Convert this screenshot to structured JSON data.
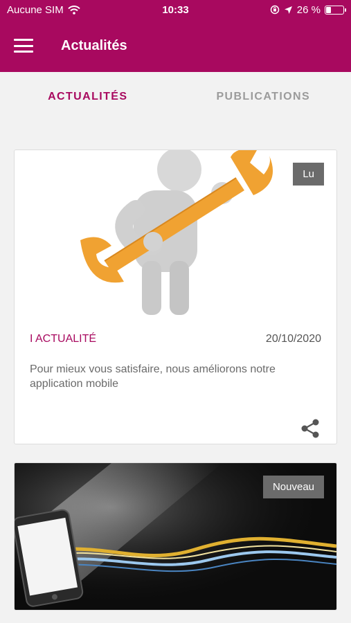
{
  "status_bar": {
    "carrier": "Aucune SIM",
    "time": "10:33",
    "battery_text": "26 %",
    "battery_level": 0.26,
    "icons": [
      "wifi-icon",
      "screen-lock-icon",
      "location-icon",
      "battery-icon"
    ]
  },
  "app_bar": {
    "title": "Actualités",
    "menu_icon": "hamburger-icon"
  },
  "tabs": [
    {
      "label": "ACTUALITÉS",
      "active": true
    },
    {
      "label": "PUBLICATIONS",
      "active": false
    }
  ],
  "cards": [
    {
      "image": "3D figure holding an orange wrench",
      "badge": "Lu",
      "category": "I ACTUALITÉ",
      "date": "20/10/2020",
      "excerpt": "Pour mieux vous satisfaire, nous améliorons notre application mobile",
      "share_icon": "share-icon"
    },
    {
      "image": "smartphone with light waves on dark background",
      "badge": "Nouveau"
    }
  ],
  "colors": {
    "primary": "#a8095f",
    "background": "#f2f2f2",
    "badge": "#6b6b6b",
    "tab_inactive": "#9b9b9b",
    "text_muted": "#6a6a6a"
  }
}
